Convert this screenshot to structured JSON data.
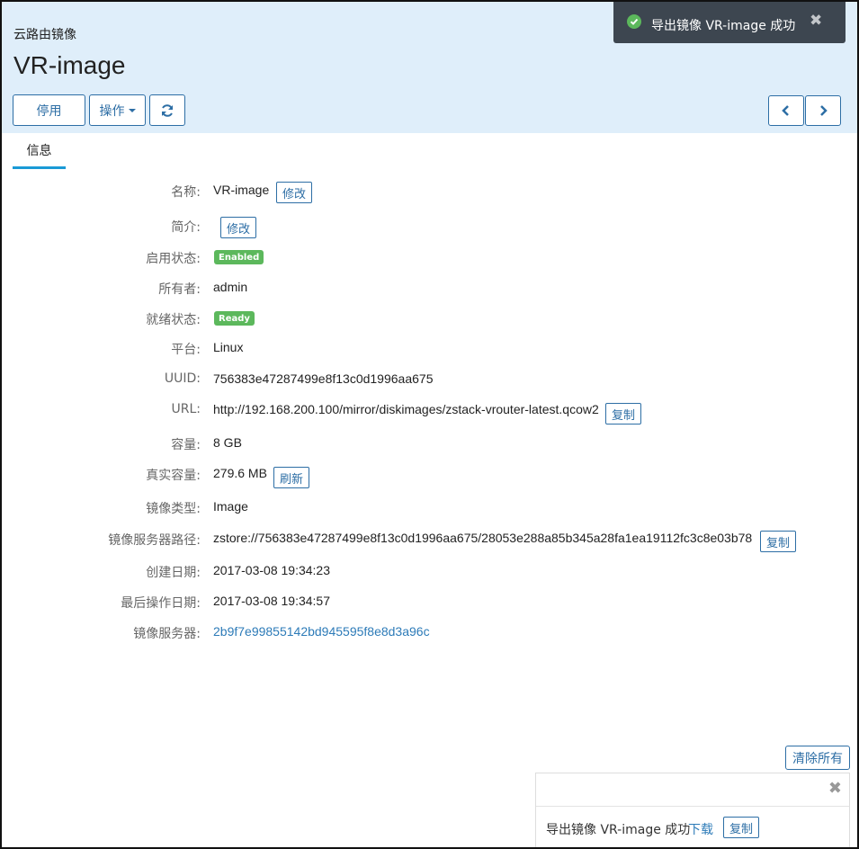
{
  "header": {
    "breadcrumb": "云路由镜像",
    "title": "VR-image",
    "actions": {
      "disable_label": "停用",
      "operations_label": "操作",
      "refresh_icon": "refresh-icon",
      "prev_icon": "chevron-left-icon",
      "next_icon": "chevron-right-icon"
    }
  },
  "tabs": [
    {
      "label": "信息"
    }
  ],
  "fields": {
    "name": {
      "label": "名称:",
      "value": "VR-image",
      "action": "修改"
    },
    "description": {
      "label": "简介:",
      "value": "",
      "action": "修改"
    },
    "enable_state": {
      "label": "启用状态:",
      "badge": "Enabled",
      "badge_color": "#5cb85c"
    },
    "owner": {
      "label": "所有者:",
      "value": "admin"
    },
    "ready_state": {
      "label": "就绪状态:",
      "badge": "Ready",
      "badge_color": "#5cb85c"
    },
    "platform": {
      "label": "平台:",
      "value": "Linux"
    },
    "uuid": {
      "label": "UUID:",
      "value": "756383e47287499e8f13c0d1996aa675"
    },
    "url": {
      "label": "URL:",
      "value": "http://192.168.200.100/mirror/diskimages/zstack-vrouter-latest.qcow2",
      "action": "复制"
    },
    "size": {
      "label": "容量:",
      "value": "8 GB"
    },
    "actual_size": {
      "label": "真实容量:",
      "value": "279.6 MB",
      "action": "刷新"
    },
    "image_type": {
      "label": "镜像类型:",
      "value": "Image"
    },
    "install_path": {
      "label": "镜像服务器路径:",
      "value": "zstore://756383e47287499e8f13c0d1996aa675/28053e288a85b345a28fa1ea19112fc3c8e03b78",
      "action": "复制"
    },
    "created": {
      "label": "创建日期:",
      "value": "2017-03-08 19:34:23"
    },
    "last_op": {
      "label": "最后操作日期:",
      "value": "2017-03-08 19:34:57"
    },
    "backup_storage": {
      "label": "镜像服务器:",
      "value": "2b9f7e99855142bd945595f8e8d3a96c"
    }
  },
  "toast": {
    "message": "导出镜像 VR-image 成功",
    "close": "✖",
    "color": "#3d4650",
    "icon_color": "#5cb85c"
  },
  "notifications": {
    "clear_all": "清除所有",
    "close": "✖",
    "items": [
      {
        "text": "导出镜像 VR-image 成功",
        "download": "下载",
        "copy": "复制"
      }
    ]
  },
  "colors": {
    "accent": "#2d6ea5",
    "header_bg": "#dfeefa",
    "tab_underline": "#1a9ad6",
    "link": "#2d7bb8"
  }
}
